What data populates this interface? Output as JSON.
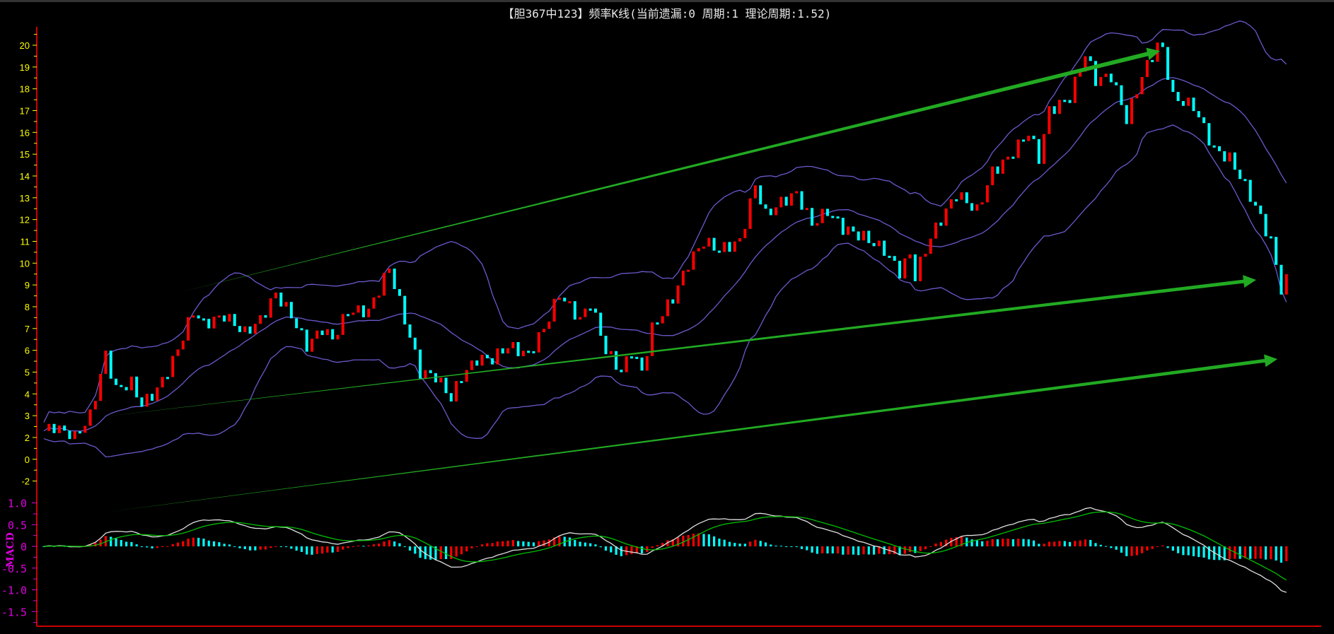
{
  "title": "【胆367中123】频率K线(当前遗漏:0 周期:1 理论周期:1.52)",
  "chart_data": [
    {
      "type": "candlestick",
      "name": "频率K线",
      "y_ticks": [
        "20",
        "19",
        "18",
        "17",
        "16",
        "15",
        "14",
        "13",
        "12",
        "11",
        "10",
        "9",
        "8",
        "7",
        "6",
        "5",
        "4",
        "3",
        "2",
        "0",
        "-2"
      ],
      "indicators": [
        "BOLL upper",
        "BOLL middle",
        "BOLL lower"
      ],
      "price_path": [
        [
          0,
          2.3
        ],
        [
          2,
          2.5
        ],
        [
          6,
          2.0
        ],
        [
          9,
          3.0
        ],
        [
          12,
          5.8
        ],
        [
          14,
          4.2
        ],
        [
          17,
          4.5
        ],
        [
          19,
          3.5
        ],
        [
          22,
          4.2
        ],
        [
          25,
          5.5
        ],
        [
          29,
          7.8
        ],
        [
          31,
          7.2
        ],
        [
          35,
          7.6
        ],
        [
          39,
          6.8
        ],
        [
          42,
          7.4
        ],
        [
          45,
          8.6
        ],
        [
          48,
          7.6
        ],
        [
          51,
          6.2
        ],
        [
          54,
          7.0
        ],
        [
          56,
          6.5
        ],
        [
          59,
          7.8
        ],
        [
          63,
          7.8
        ],
        [
          67,
          9.8
        ],
        [
          69,
          8.2
        ],
        [
          73,
          5.0
        ],
        [
          76,
          4.8
        ],
        [
          79,
          3.8
        ],
        [
          81,
          4.8
        ],
        [
          84,
          5.6
        ],
        [
          87,
          5.6
        ],
        [
          90,
          6.2
        ],
        [
          94,
          5.8
        ],
        [
          97,
          7.0
        ],
        [
          100,
          8.6
        ],
        [
          104,
          7.4
        ],
        [
          106,
          8.2
        ],
        [
          109,
          6.0
        ],
        [
          112,
          5.0
        ],
        [
          114,
          6.0
        ],
        [
          116,
          5.0
        ],
        [
          118,
          7.0
        ],
        [
          122,
          8.4
        ],
        [
          125,
          10.0
        ],
        [
          128,
          11.0
        ],
        [
          131,
          10.6
        ],
        [
          135,
          11.0
        ],
        [
          138,
          13.6
        ],
        [
          140,
          12.2
        ],
        [
          143,
          12.8
        ],
        [
          146,
          13.2
        ],
        [
          149,
          11.8
        ],
        [
          152,
          12.4
        ],
        [
          155,
          11.6
        ],
        [
          159,
          11.2
        ],
        [
          163,
          10.6
        ],
        [
          166,
          9.6
        ],
        [
          168,
          10.4
        ],
        [
          169,
          9.4
        ],
        [
          172,
          11.2
        ],
        [
          177,
          13.2
        ],
        [
          181,
          12.4
        ],
        [
          184,
          14.2
        ],
        [
          187,
          14.8
        ],
        [
          191,
          16.0
        ],
        [
          193,
          14.8
        ],
        [
          195,
          17.0
        ],
        [
          199,
          17.6
        ],
        [
          202,
          19.6
        ],
        [
          204,
          18.4
        ],
        [
          207,
          18.6
        ],
        [
          210,
          16.6
        ],
        [
          213,
          18.6
        ],
        [
          216,
          20.0
        ],
        [
          217,
          19.8
        ],
        [
          219,
          17.6
        ],
        [
          223,
          17.2
        ],
        [
          227,
          15.2
        ],
        [
          230,
          14.8
        ],
        [
          232,
          14.0
        ],
        [
          235,
          12.6
        ],
        [
          238,
          11.0
        ],
        [
          240,
          8.8
        ],
        [
          241,
          9.2
        ]
      ],
      "up_color": "#ff0000",
      "down_color": "#00ffff",
      "band_color": "#6a5acd",
      "annotation_color": "#22aa22"
    },
    {
      "type": "macd",
      "label": "MACD",
      "y_ticks": [
        "1.0",
        "0.5",
        "0",
        "-0.5",
        "-1.0",
        "-1.5"
      ],
      "ylim": [
        -1.7,
        1.1
      ],
      "dif_color": "#e0e0e0",
      "dea_color": "#00c000"
    }
  ],
  "colors": {
    "axis": "#cc0000",
    "price_tick": "#ffff00",
    "macd_tick": "#e000e0"
  }
}
